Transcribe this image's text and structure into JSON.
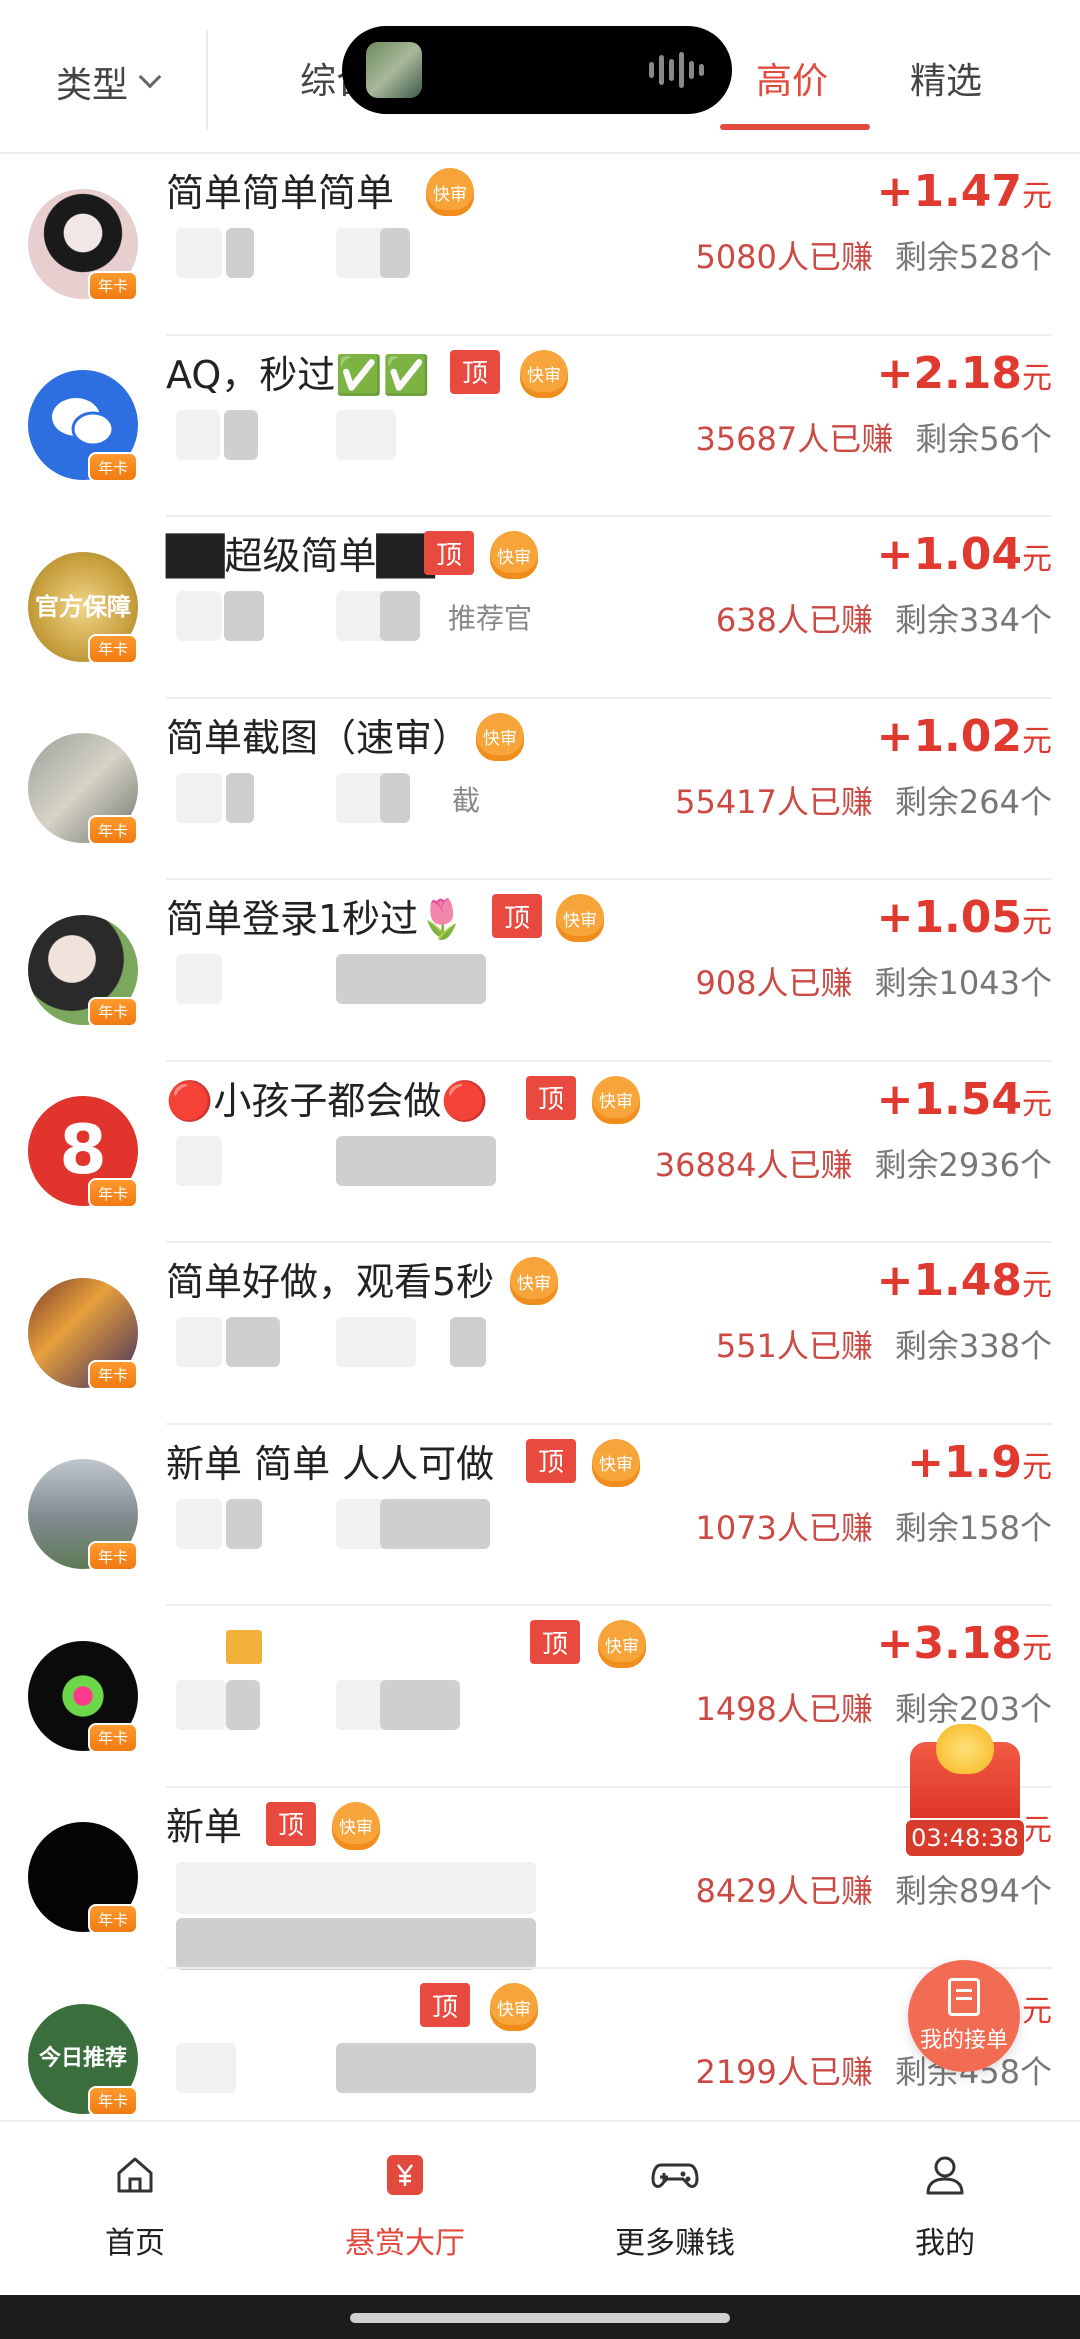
{
  "header": {
    "type_label": "类型",
    "tabs": [
      {
        "label": "综合"
      },
      {
        "label": "高价",
        "active": true
      },
      {
        "label": "精选"
      }
    ]
  },
  "tasks": [
    {
      "title": "简单简单简单",
      "tags": [
        "快审"
      ],
      "price_sign": "+",
      "price": "1.47",
      "unit": "元",
      "earned": "5080人已赚",
      "remain": "剩余528个"
    },
    {
      "title": "AQ，秒过✅✅",
      "tags": [
        "顶",
        "快审"
      ],
      "price_sign": "+",
      "price": "2.18",
      "unit": "元",
      "earned": "35687人已赚",
      "remain": "剩余56个"
    },
    {
      "title": "██超级简单██",
      "tags": [
        "顶",
        "快审"
      ],
      "price_sign": "+",
      "price": "1.04",
      "unit": "元",
      "earned": "638人已赚",
      "remain": "剩余334个",
      "sub_fragment": "推荐官",
      "avatar_text": "官方保障"
    },
    {
      "title": "简单截图（速审）",
      "tags": [
        "快审"
      ],
      "price_sign": "+",
      "price": "1.02",
      "unit": "元",
      "earned": "55417人已赚",
      "remain": "剩余264个",
      "sub_fragment": "截"
    },
    {
      "title": "简单登录1秒过🌷",
      "tags": [
        "顶",
        "快审"
      ],
      "price_sign": "+",
      "price": "1.05",
      "unit": "元",
      "earned": "908人已赚",
      "remain": "剩余1043个"
    },
    {
      "title": "🔴小孩子都会做🔴",
      "tags": [
        "顶",
        "快审"
      ],
      "price_sign": "+",
      "price": "1.54",
      "unit": "元",
      "earned": "36884人已赚",
      "remain": "剩余2936个",
      "avatar_text": "8"
    },
    {
      "title": "简单好做，观看5秒",
      "tags": [
        "快审"
      ],
      "price_sign": "+",
      "price": "1.48",
      "unit": "元",
      "earned": "551人已赚",
      "remain": "剩余338个"
    },
    {
      "title": "新单 简单 人人可做",
      "tags": [
        "顶",
        "快审"
      ],
      "price_sign": "+",
      "price": "1.9",
      "unit": "元",
      "earned": "1073人已赚",
      "remain": "剩余158个"
    },
    {
      "title": "",
      "tags": [
        "顶",
        "快审"
      ],
      "price_sign": "+",
      "price": "3.18",
      "unit": "元",
      "earned": "1498人已赚",
      "remain": "剩余203个"
    },
    {
      "title": "新单",
      "tags": [
        "顶",
        "快审"
      ],
      "price_sign": "",
      "price": "",
      "unit": "元",
      "earned": "8429人已赚",
      "remain": "剩余894个"
    },
    {
      "title": "",
      "tags": [
        "顶",
        "快审"
      ],
      "price_sign": "",
      "price": "",
      "unit": "元",
      "earned": "2199人已赚",
      "remain": "剩余458个",
      "avatar_text": "今日推荐"
    }
  ],
  "avatar_badge": "年卡",
  "float_timer": "03:48:38",
  "my_orders_label": "我的接单",
  "nav": [
    {
      "label": "首页"
    },
    {
      "label": "悬赏大厅",
      "active": true
    },
    {
      "label": "更多赚钱"
    },
    {
      "label": "我的"
    }
  ],
  "colors": {
    "accent": "#e34a3e",
    "price": "#e0392f",
    "tag_top": "#e94a3f",
    "tag_fast": "#f7a53b"
  },
  "icons": [
    "chevron-down-icon",
    "home-icon",
    "yen-icon",
    "gamepad-icon",
    "user-icon",
    "document-icon"
  ]
}
